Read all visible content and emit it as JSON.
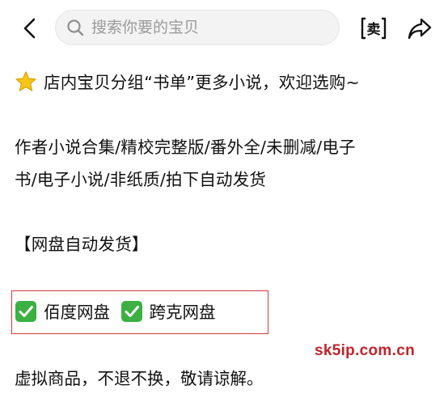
{
  "header": {
    "back_icon": "chevron-left-icon",
    "search": {
      "placeholder": "搜索你要的宝贝",
      "value": ""
    },
    "sell_label": "卖",
    "share_icon": "share-arrow-icon"
  },
  "description": {
    "intro": "店内宝贝分组“书单”更多小说，欢迎选购~",
    "line1": "作者小说合集/精校完整版/番外全/未删减/电子",
    "line2": "书/电子小说/非纸质/拍下自动发货",
    "section_title": "【网盘自动发货】",
    "drives": [
      {
        "label": "佰度网盘"
      },
      {
        "label": "跨克网盘"
      }
    ],
    "notice": "虚拟商品，不退不换，敬请谅解。"
  },
  "watermark": "sk5ip.com.cn",
  "colors": {
    "highlight_border": "#d23a3a",
    "watermark": "#c0232a",
    "check_green": "#3cb043",
    "star_yellow": "#f5c518"
  }
}
